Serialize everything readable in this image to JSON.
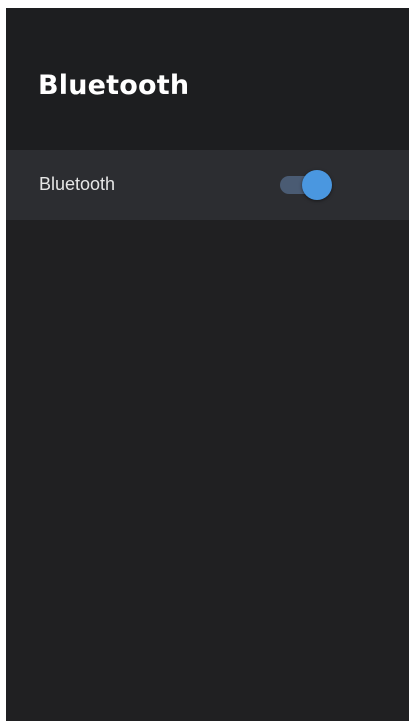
{
  "header": {
    "title": "Bluetooth"
  },
  "settings": [
    {
      "label": "Bluetooth",
      "toggle_on": true
    }
  ],
  "colors": {
    "background": "#202022",
    "header_background": "#1d1e20",
    "row_background": "#2c2d31",
    "toggle_track": "#4a5b73",
    "toggle_thumb": "#4a97e0"
  }
}
